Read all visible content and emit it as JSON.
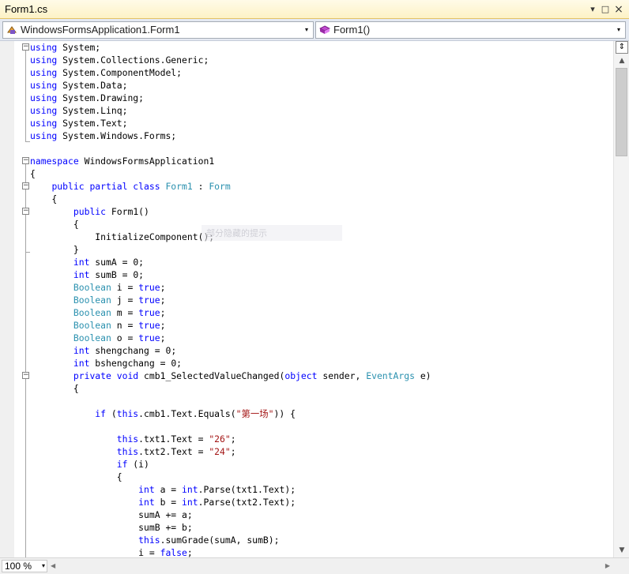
{
  "window": {
    "tab_title": "Form1.cs"
  },
  "nav": {
    "class_combo": "WindowsFormsApplication1.Form1",
    "member_combo": "Form1()"
  },
  "ghost_hint": "部分隐藏的提示",
  "code_lines": [
    [
      [
        "kw",
        "using"
      ],
      [
        "p",
        " System;"
      ]
    ],
    [
      [
        "kw",
        "using"
      ],
      [
        "p",
        " System.Collections.Generic;"
      ]
    ],
    [
      [
        "kw",
        "using"
      ],
      [
        "p",
        " System.ComponentModel;"
      ]
    ],
    [
      [
        "kw",
        "using"
      ],
      [
        "p",
        " System.Data;"
      ]
    ],
    [
      [
        "kw",
        "using"
      ],
      [
        "p",
        " System.Drawing;"
      ]
    ],
    [
      [
        "kw",
        "using"
      ],
      [
        "p",
        " System.Linq;"
      ]
    ],
    [
      [
        "kw",
        "using"
      ],
      [
        "p",
        " System.Text;"
      ]
    ],
    [
      [
        "kw",
        "using"
      ],
      [
        "p",
        " System.Windows.Forms;"
      ]
    ],
    [
      [
        "p",
        ""
      ]
    ],
    [
      [
        "kw",
        "namespace"
      ],
      [
        "p",
        " WindowsFormsApplication1"
      ]
    ],
    [
      [
        "p",
        "{"
      ]
    ],
    [
      [
        "p",
        "    "
      ],
      [
        "kw",
        "public partial class"
      ],
      [
        "p",
        " "
      ],
      [
        "ty",
        "Form1"
      ],
      [
        "p",
        " : "
      ],
      [
        "ty",
        "Form"
      ]
    ],
    [
      [
        "p",
        "    {"
      ]
    ],
    [
      [
        "p",
        "        "
      ],
      [
        "kw",
        "public"
      ],
      [
        "p",
        " Form1()"
      ]
    ],
    [
      [
        "p",
        "        {"
      ]
    ],
    [
      [
        "p",
        "            InitializeComponent();"
      ]
    ],
    [
      [
        "p",
        "        }"
      ]
    ],
    [
      [
        "p",
        "        "
      ],
      [
        "kw",
        "int"
      ],
      [
        "p",
        " sumA = 0;"
      ]
    ],
    [
      [
        "p",
        "        "
      ],
      [
        "kw",
        "int"
      ],
      [
        "p",
        " sumB = 0;"
      ]
    ],
    [
      [
        "p",
        "        "
      ],
      [
        "ty",
        "Boolean"
      ],
      [
        "p",
        " i = "
      ],
      [
        "kw",
        "true"
      ],
      [
        "p",
        ";"
      ]
    ],
    [
      [
        "p",
        "        "
      ],
      [
        "ty",
        "Boolean"
      ],
      [
        "p",
        " j = "
      ],
      [
        "kw",
        "true"
      ],
      [
        "p",
        ";"
      ]
    ],
    [
      [
        "p",
        "        "
      ],
      [
        "ty",
        "Boolean"
      ],
      [
        "p",
        " m = "
      ],
      [
        "kw",
        "true"
      ],
      [
        "p",
        ";"
      ]
    ],
    [
      [
        "p",
        "        "
      ],
      [
        "ty",
        "Boolean"
      ],
      [
        "p",
        " n = "
      ],
      [
        "kw",
        "true"
      ],
      [
        "p",
        ";"
      ]
    ],
    [
      [
        "p",
        "        "
      ],
      [
        "ty",
        "Boolean"
      ],
      [
        "p",
        " o = "
      ],
      [
        "kw",
        "true"
      ],
      [
        "p",
        ";"
      ]
    ],
    [
      [
        "p",
        "        "
      ],
      [
        "kw",
        "int"
      ],
      [
        "p",
        " shengchang = 0;"
      ]
    ],
    [
      [
        "p",
        "        "
      ],
      [
        "kw",
        "int"
      ],
      [
        "p",
        " bshengchang = 0;"
      ]
    ],
    [
      [
        "p",
        "        "
      ],
      [
        "kw",
        "private void"
      ],
      [
        "p",
        " cmb1_SelectedValueChanged("
      ],
      [
        "kw",
        "object"
      ],
      [
        "p",
        " sender, "
      ],
      [
        "ty",
        "EventArgs"
      ],
      [
        "p",
        " e)"
      ]
    ],
    [
      [
        "p",
        "        {"
      ]
    ],
    [
      [
        "p",
        ""
      ]
    ],
    [
      [
        "p",
        "            "
      ],
      [
        "kw",
        "if"
      ],
      [
        "p",
        " ("
      ],
      [
        "kw",
        "this"
      ],
      [
        "p",
        ".cmb1.Text.Equals("
      ],
      [
        "st",
        "\"第一场\""
      ],
      [
        "p",
        ")) {"
      ]
    ],
    [
      [
        "p",
        ""
      ]
    ],
    [
      [
        "p",
        "                "
      ],
      [
        "kw",
        "this"
      ],
      [
        "p",
        ".txt1.Text = "
      ],
      [
        "st",
        "\"26\""
      ],
      [
        "p",
        ";"
      ]
    ],
    [
      [
        "p",
        "                "
      ],
      [
        "kw",
        "this"
      ],
      [
        "p",
        ".txt2.Text = "
      ],
      [
        "st",
        "\"24\""
      ],
      [
        "p",
        ";"
      ]
    ],
    [
      [
        "p",
        "                "
      ],
      [
        "kw",
        "if"
      ],
      [
        "p",
        " (i)"
      ]
    ],
    [
      [
        "p",
        "                {"
      ]
    ],
    [
      [
        "p",
        "                    "
      ],
      [
        "kw",
        "int"
      ],
      [
        "p",
        " a = "
      ],
      [
        "kw",
        "int"
      ],
      [
        "p",
        ".Parse(txt1.Text);"
      ]
    ],
    [
      [
        "p",
        "                    "
      ],
      [
        "kw",
        "int"
      ],
      [
        "p",
        " b = "
      ],
      [
        "kw",
        "int"
      ],
      [
        "p",
        ".Parse(txt2.Text);"
      ]
    ],
    [
      [
        "p",
        "                    sumA += a;"
      ]
    ],
    [
      [
        "p",
        "                    sumB += b;"
      ]
    ],
    [
      [
        "p",
        "                    "
      ],
      [
        "kw",
        "this"
      ],
      [
        "p",
        ".sumGrade(sumA, sumB);"
      ]
    ],
    [
      [
        "p",
        "                    i = "
      ],
      [
        "kw",
        "false"
      ],
      [
        "p",
        ";"
      ]
    ]
  ],
  "zoom": {
    "value": "100 %"
  },
  "colors": {
    "keyword": "#0000ff",
    "type": "#2b91af",
    "string": "#a31515",
    "tab_bg": "#fdf2c6"
  },
  "icons": {
    "pin": "▾",
    "maximize": "□",
    "close": "×",
    "combo_arrow": "▾"
  }
}
